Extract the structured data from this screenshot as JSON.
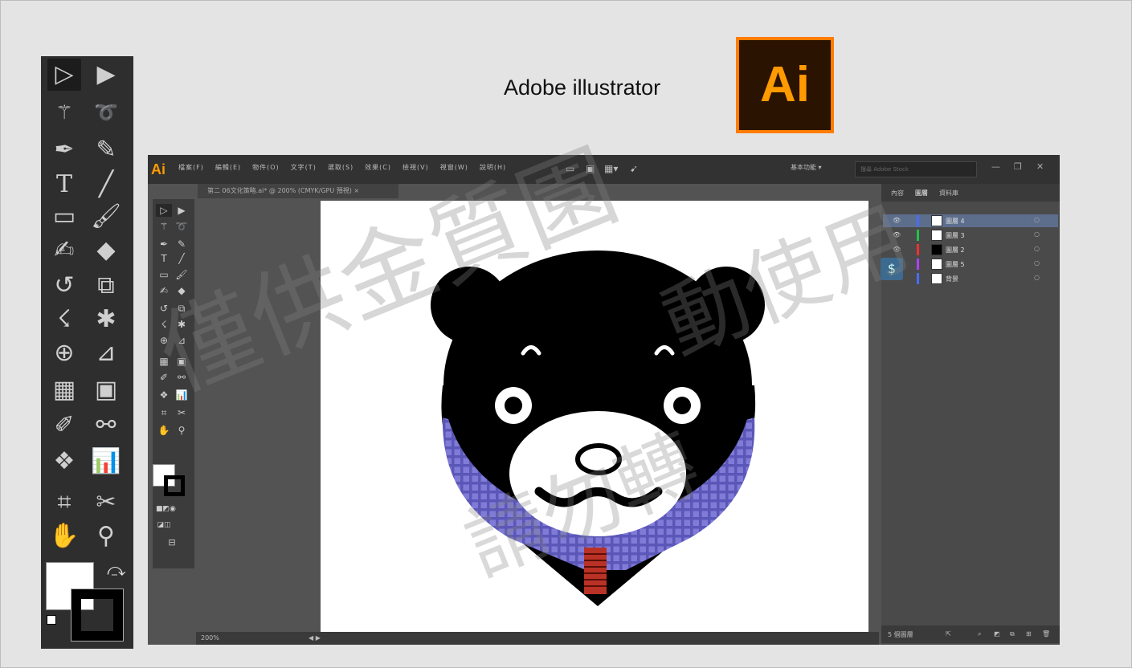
{
  "header": {
    "brand_label": "Adobe illustrator",
    "logo_text": "Ai"
  },
  "big_toolbar": {
    "tools": [
      "selection-tool",
      "direct-selection-tool",
      "magic-wand-tool",
      "lasso-tool",
      "pen-tool",
      "curvature-tool",
      "type-tool",
      "line-tool",
      "rectangle-tool",
      "paintbrush-tool",
      "shaper-tool",
      "eraser-tool",
      "rotate-tool",
      "scale-tool",
      "warp-tool",
      "puppet-warp-tool",
      "shape-builder-tool",
      "perspective-grid-tool",
      "mesh-tool",
      "gradient-tool",
      "eyedropper-tool",
      "blend-tool",
      "symbol-sprayer-tool",
      "graph-tool",
      "artboard-tool",
      "slice-tool",
      "hand-tool",
      "zoom-tool"
    ]
  },
  "window": {
    "app_icon": "Ai",
    "menus": [
      "檔案(F)",
      "編輯(E)",
      "物件(O)",
      "文字(T)",
      "選取(S)",
      "效果(C)",
      "檢視(V)",
      "視窗(W)",
      "說明(H)"
    ],
    "workspace": "基本功能 ▾",
    "search_placeholder": "搜尋 Adobe Stock",
    "doc_tab": "第二 06文化策略.ai* @ 200% (CMYK/GPU 預視)  ×",
    "panel_tabs": [
      "內容",
      "圖層",
      "資料庫"
    ],
    "layers": [
      {
        "name": "圖層 4",
        "color": "#4a6cff"
      },
      {
        "name": "圖層 3",
        "color": "#22c24a"
      },
      {
        "name": "圖層 2",
        "color": "#ff3030"
      },
      {
        "name": "圖層 5",
        "color": "#b040ff"
      },
      {
        "name": "背景",
        "color": "#4a6cff"
      }
    ],
    "panel_footer": "5 個圖層",
    "status_zoom": "200%"
  },
  "watermark": {
    "line1": "僅供金質園",
    "line2": "動使用",
    "line3": "請勿轉"
  }
}
